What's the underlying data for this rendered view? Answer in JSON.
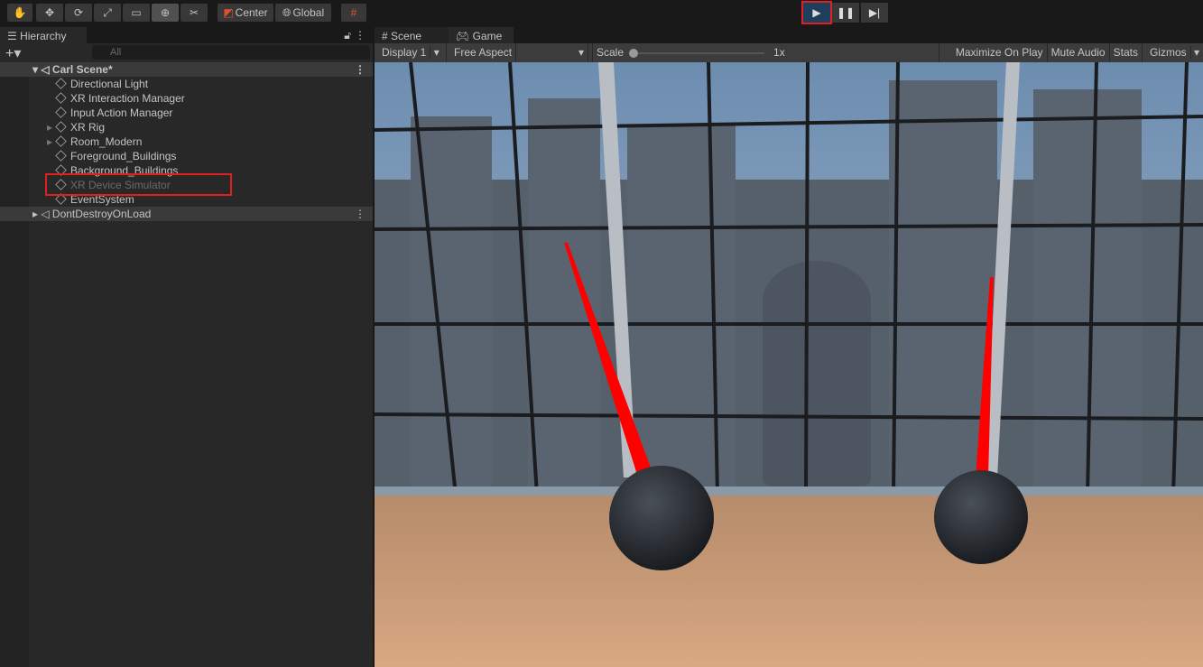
{
  "toolbar": {
    "tools": [
      "hand-tool",
      "move-tool",
      "rotate-tool",
      "scale-tool",
      "rect-tool",
      "transform-tool",
      "custom-tool"
    ],
    "pivot": "Center",
    "space": "Global"
  },
  "hierarchy": {
    "tab": "Hierarchy",
    "search_placeholder": "All",
    "scene": "Carl Scene*",
    "items": [
      {
        "label": "Directional Light"
      },
      {
        "label": "XR Interaction Manager"
      },
      {
        "label": "Input Action Manager"
      },
      {
        "label": "XR Rig",
        "expandable": true
      },
      {
        "label": "Room_Modern",
        "expandable": true
      },
      {
        "label": "Foreground_Buildings"
      },
      {
        "label": "Background_Buildings"
      },
      {
        "label": "XR Device Simulator",
        "disabled": true,
        "highlighted": true
      },
      {
        "label": "EventSystem"
      }
    ],
    "dont_destroy": "DontDestroyOnLoad"
  },
  "game": {
    "tabs": [
      "Scene",
      "Game"
    ],
    "display": "Display 1",
    "aspect": "Free Aspect",
    "scale_label": "Scale",
    "scale_value": "1x",
    "maximize": "Maximize On Play",
    "mute": "Mute Audio",
    "stats": "Stats",
    "gizmos": "Gizmos"
  },
  "colors": {
    "accent": "#e02020",
    "play_active": "#1e3f5c"
  }
}
